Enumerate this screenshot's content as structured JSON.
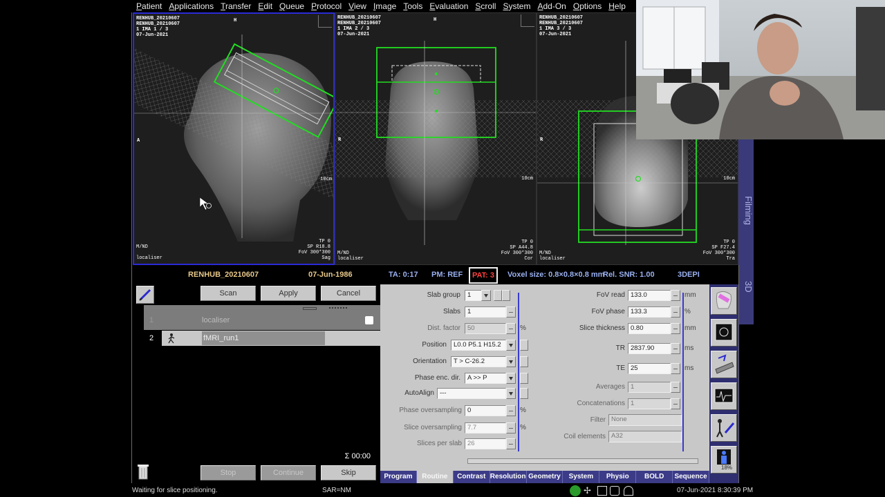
{
  "menu": [
    "Patient",
    "Applications",
    "Transfer",
    "Edit",
    "Queue",
    "Protocol",
    "View",
    "Image",
    "Tools",
    "Evaluation",
    "Scroll",
    "System",
    "Add-On",
    "Options",
    "Help"
  ],
  "viewports": [
    {
      "header": "RENHUB_20210607\nRENHUB_20210607\n1 IMA 1 / 3\n07-Jun-2021",
      "top_mark": "H",
      "left_mark": "A",
      "scale": "10cm",
      "bottom_left": "M/ND\n\nlocaliser",
      "bottom_right": "TP 0\nSP R18.8\nFoV 300*300\nSag"
    },
    {
      "header": "RENHUB_20210607\nRENHUB_20210607\n1 IMA 2 / 3\n07-Jun-2021",
      "top_mark": "H",
      "left_mark": "R",
      "scale": "10cm",
      "bottom_left": "M/ND\nlocaliser",
      "bottom_right": "TP 0\nSP A44.8\nFoV 300*300\nCor"
    },
    {
      "header": "RENHUB_20210607\nRENHUB_20210607\n1 IMA 3 / 3\n07-Jun-2021",
      "top_mark": "",
      "left_mark": "R",
      "scale": "10cm",
      "bottom_left": "M/ND\nlocaliser",
      "bottom_right": "TP 0\nSP F27.4\nFoV 300*300\nTra"
    }
  ],
  "side_tabs": [
    "Filming",
    "3D"
  ],
  "info": {
    "patient": "RENHUB_20210607",
    "dob": "07-Jun-1986",
    "ta": "TA: 0:17",
    "pm": "PM: REF",
    "pat": "PAT: 3",
    "voxel": "Voxel size: 0.8×0.8×0.8 mm",
    "snr": "Rel. SNR: 1.00",
    "seq": "3DEPI"
  },
  "queue": {
    "buttons": {
      "scan": "Scan",
      "apply": "Apply",
      "cancel": "Cancel",
      "stop": "Stop",
      "continue": "Continue",
      "skip": "Skip"
    },
    "rows": [
      {
        "num": "1",
        "name": "localiser"
      },
      {
        "num": "2",
        "name": "fMRI_run1"
      }
    ],
    "sigma": "Σ 00:00"
  },
  "params": {
    "slab_group": {
      "label": "Slab group",
      "value": "1"
    },
    "slabs": {
      "label": "Slabs",
      "value": "1"
    },
    "dist_factor": {
      "label": "Dist. factor",
      "value": "50",
      "unit": "%"
    },
    "position": {
      "label": "Position",
      "value": "L0.0 P5.1 H15.2"
    },
    "orientation": {
      "label": "Orientation",
      "value": "T > C-26.2"
    },
    "phase_enc_dir": {
      "label": "Phase enc. dir.",
      "value": "A >> P"
    },
    "autoalign": {
      "label": "AutoAlign",
      "value": "---"
    },
    "phase_oversampling": {
      "label": "Phase oversampling",
      "value": "0",
      "unit": "%"
    },
    "slice_oversampling": {
      "label": "Slice oversampling",
      "value": "7.7",
      "unit": "%"
    },
    "slices_per_slab": {
      "label": "Slices per slab",
      "value": "26"
    },
    "fov_read": {
      "label": "FoV read",
      "value": "133.0",
      "unit": "mm"
    },
    "fov_phase": {
      "label": "FoV phase",
      "value": "133.3",
      "unit": "%"
    },
    "slice_thickness": {
      "label": "Slice thickness",
      "value": "0.80",
      "unit": "mm"
    },
    "tr": {
      "label": "TR",
      "value": "2837.90",
      "unit": "ms"
    },
    "te": {
      "label": "TE",
      "value": "25",
      "unit": "ms"
    },
    "averages": {
      "label": "Averages",
      "value": "1"
    },
    "concatenations": {
      "label": "Concatenations",
      "value": "1"
    },
    "filter": {
      "label": "Filter",
      "value": "None"
    },
    "coil_elements": {
      "label": "Coil elements",
      "value": "A32"
    }
  },
  "param_tabs": [
    "Program",
    "Routine",
    "Contrast",
    "Resolution",
    "Geometry",
    "System",
    "Physio",
    "BOLD",
    "Sequence"
  ],
  "active_param_tab": 1,
  "tool_icons": [
    "slab-positioning-icon",
    "inline-display-icon",
    "patient-table-icon",
    "physio-signal-icon",
    "injector-icon",
    "sar-status-icon"
  ],
  "sar_percent": "18%",
  "status": {
    "message": "Waiting for slice positioning.",
    "sar": "SAR=NM",
    "datetime": "07-Jun-2021 8:30:39 PM"
  }
}
